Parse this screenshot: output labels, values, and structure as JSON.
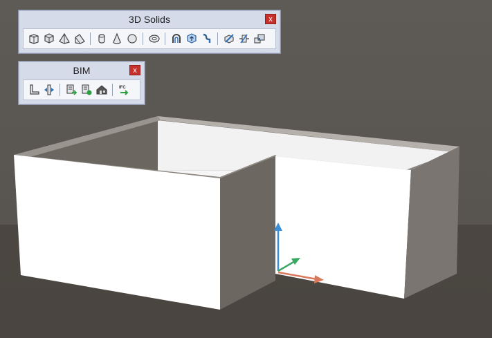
{
  "toolbars": {
    "solids": {
      "title": "3D Solids",
      "close_label": "x",
      "icons": [
        "box-icon",
        "cube-icon",
        "pyramid-icon",
        "wedge-icon",
        "cylinder-icon",
        "cone-icon",
        "sphere-icon",
        "torus-icon",
        "revolve-icon",
        "extrude-icon",
        "sweep-icon",
        "slice-icon",
        "section-icon",
        "interfere-icon"
      ]
    },
    "bim": {
      "title": "BIM",
      "close_label": "x",
      "ifc_label": "IFC",
      "icons": [
        "wall-icon",
        "flip-wall-icon",
        "bim-attach-icon",
        "bim-classify-icon",
        "bim-building-icon",
        "ifc-export-icon"
      ]
    }
  },
  "colors": {
    "toolbar_bg": "#d6dbe9",
    "close_red": "#c7302b",
    "viewport_bg": "#5a5651",
    "axis_z": "#3a8fd6",
    "axis_y": "#3aa862",
    "axis_x": "#d9785a"
  }
}
